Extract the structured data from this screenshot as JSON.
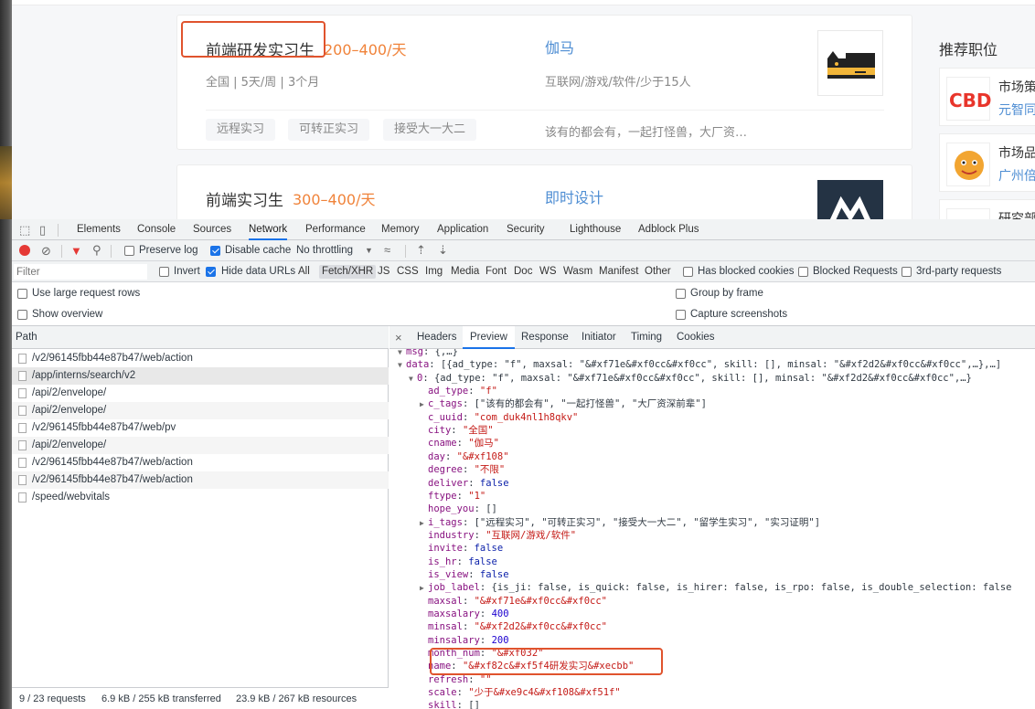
{
  "jobs": [
    {
      "title": "前端研发实习生",
      "salary": "200–400/天",
      "company": "伽马",
      "meta": "全国 | 5天/周 | 3个月",
      "company_meta": "互联网/游戏/软件/少于15人",
      "tags": [
        "远程实习",
        "可转正实习",
        "接受大一大二"
      ],
      "company_desc": "该有的都会有，一起打怪兽，大厂资…"
    },
    {
      "title": "前端实习生",
      "salary": "300–400/天",
      "company": "即时设计"
    }
  ],
  "sidebar": {
    "title": "推荐职位",
    "items": [
      {
        "name": "市场策",
        "company": "元智同",
        "logo": "CBD"
      },
      {
        "name": "市场品",
        "company": "广州倍"
      },
      {
        "name": "研究部"
      }
    ]
  },
  "devtools": {
    "tabs": [
      "Elements",
      "Console",
      "Sources",
      "Network",
      "Performance",
      "Memory",
      "Application",
      "Security",
      "Lighthouse",
      "Adblock Plus"
    ],
    "active_tab": "Network",
    "toolbar": {
      "preserve_log": "Preserve log",
      "disable_cache": "Disable cache",
      "throttling": "No throttling"
    },
    "filter": {
      "placeholder": "Filter",
      "invert": "Invert",
      "hide_data_urls": "Hide data URLs",
      "types": [
        "All",
        "Fetch/XHR",
        "JS",
        "CSS",
        "Img",
        "Media",
        "Font",
        "Doc",
        "WS",
        "Wasm",
        "Manifest",
        "Other"
      ],
      "active_type": "Fetch/XHR",
      "has_blocked_cookies": "Has blocked cookies",
      "blocked_requests": "Blocked Requests",
      "third_party": "3rd-party requests"
    },
    "options": {
      "large_rows": "Use large request rows",
      "overview": "Show overview",
      "group_by_frame": "Group by frame",
      "capture_screenshots": "Capture screenshots"
    },
    "requests": {
      "header": "Path",
      "rows": [
        "/v2/96145fbb44e87b47/web/action",
        "/app/interns/search/v2",
        "/api/2/envelope/",
        "/api/2/envelope/",
        "/v2/96145fbb44e87b47/web/pv",
        "/api/2/envelope/",
        "/v2/96145fbb44e87b47/web/action",
        "/v2/96145fbb44e87b47/web/action",
        "/speed/webvitals"
      ],
      "selected_index": 1
    },
    "status": {
      "requests": "9 / 23 requests",
      "transferred": "6.9 kB / 255 kB transferred",
      "resources": "23.9 kB / 267 kB resources"
    },
    "preview_tabs": [
      "Headers",
      "Preview",
      "Response",
      "Initiator",
      "Timing",
      "Cookies"
    ],
    "preview_active": "Preview",
    "json_lines": [
      {
        "indent": 1,
        "tri": "▼",
        "parts": [
          [
            "k",
            "msg"
          ],
          [
            "p",
            ": {,…}"
          ]
        ]
      },
      {
        "indent": 1,
        "tri": "▼",
        "parts": [
          [
            "k",
            "data"
          ],
          [
            "p",
            ": [{ad_type: \"f\", maxsal: \"&#xf71e&#xf0cc&#xf0cc\", skill: [], minsal: \"&#xf2d2&#xf0cc&#xf0cc\",…},…]"
          ]
        ]
      },
      {
        "indent": 2,
        "tri": "▼",
        "parts": [
          [
            "k",
            "0"
          ],
          [
            "p",
            ": {ad_type: \"f\", maxsal: \"&#xf71e&#xf0cc&#xf0cc\", skill: [], minsal: \"&#xf2d2&#xf0cc&#xf0cc\",…}"
          ]
        ]
      },
      {
        "indent": 3,
        "tri": "",
        "parts": [
          [
            "k",
            "ad_type"
          ],
          [
            "p",
            ": "
          ],
          [
            "s",
            "\"f\""
          ]
        ]
      },
      {
        "indent": 3,
        "tri": "▶",
        "parts": [
          [
            "k",
            "c_tags"
          ],
          [
            "p",
            ": [\"该有的都会有\", \"一起打怪兽\", \"大厂资深前辈\"]"
          ]
        ]
      },
      {
        "indent": 3,
        "tri": "",
        "parts": [
          [
            "k",
            "c_uuid"
          ],
          [
            "p",
            ": "
          ],
          [
            "s",
            "\"com_duk4nl1h8qkv\""
          ]
        ]
      },
      {
        "indent": 3,
        "tri": "",
        "parts": [
          [
            "k",
            "city"
          ],
          [
            "p",
            ": "
          ],
          [
            "s",
            "\"全国\""
          ]
        ]
      },
      {
        "indent": 3,
        "tri": "",
        "parts": [
          [
            "k",
            "cname"
          ],
          [
            "p",
            ": "
          ],
          [
            "s",
            "\"伽马\""
          ]
        ]
      },
      {
        "indent": 3,
        "tri": "",
        "parts": [
          [
            "k",
            "day"
          ],
          [
            "p",
            ": "
          ],
          [
            "s",
            "\"&#xf108\""
          ]
        ]
      },
      {
        "indent": 3,
        "tri": "",
        "parts": [
          [
            "k",
            "degree"
          ],
          [
            "p",
            ": "
          ],
          [
            "s",
            "\"不限\""
          ]
        ]
      },
      {
        "indent": 3,
        "tri": "",
        "parts": [
          [
            "k",
            "deliver"
          ],
          [
            "p",
            ": "
          ],
          [
            "b",
            "false"
          ]
        ]
      },
      {
        "indent": 3,
        "tri": "",
        "parts": [
          [
            "k",
            "ftype"
          ],
          [
            "p",
            ": "
          ],
          [
            "s",
            "\"1\""
          ]
        ]
      },
      {
        "indent": 3,
        "tri": "",
        "parts": [
          [
            "k",
            "hope_you"
          ],
          [
            "p",
            ": []"
          ]
        ]
      },
      {
        "indent": 3,
        "tri": "▶",
        "parts": [
          [
            "k",
            "i_tags"
          ],
          [
            "p",
            ": [\"远程实习\", \"可转正实习\", \"接受大一大二\", \"留学生实习\", \"实习证明\"]"
          ]
        ]
      },
      {
        "indent": 3,
        "tri": "",
        "parts": [
          [
            "k",
            "industry"
          ],
          [
            "p",
            ": "
          ],
          [
            "s",
            "\"互联网/游戏/软件\""
          ]
        ]
      },
      {
        "indent": 3,
        "tri": "",
        "parts": [
          [
            "k",
            "invite"
          ],
          [
            "p",
            ": "
          ],
          [
            "b",
            "false"
          ]
        ]
      },
      {
        "indent": 3,
        "tri": "",
        "parts": [
          [
            "k",
            "is_hr"
          ],
          [
            "p",
            ": "
          ],
          [
            "b",
            "false"
          ]
        ]
      },
      {
        "indent": 3,
        "tri": "",
        "parts": [
          [
            "k",
            "is_view"
          ],
          [
            "p",
            ": "
          ],
          [
            "b",
            "false"
          ]
        ]
      },
      {
        "indent": 3,
        "tri": "▶",
        "parts": [
          [
            "k",
            "job_label"
          ],
          [
            "p",
            ": {is_ji: false, is_quick: false, is_hirer: false, is_rpo: false, is_double_selection: false"
          ]
        ]
      },
      {
        "indent": 3,
        "tri": "",
        "parts": [
          [
            "k",
            "maxsal"
          ],
          [
            "p",
            ": "
          ],
          [
            "s",
            "\"&#xf71e&#xf0cc&#xf0cc\""
          ]
        ]
      },
      {
        "indent": 3,
        "tri": "",
        "parts": [
          [
            "k",
            "maxsalary"
          ],
          [
            "p",
            ": "
          ],
          [
            "n",
            "400"
          ]
        ]
      },
      {
        "indent": 3,
        "tri": "",
        "parts": [
          [
            "k",
            "minsal"
          ],
          [
            "p",
            ": "
          ],
          [
            "s",
            "\"&#xf2d2&#xf0cc&#xf0cc\""
          ]
        ]
      },
      {
        "indent": 3,
        "tri": "",
        "parts": [
          [
            "k",
            "minsalary"
          ],
          [
            "p",
            ": "
          ],
          [
            "n",
            "200"
          ]
        ]
      },
      {
        "indent": 3,
        "tri": "",
        "parts": [
          [
            "k",
            "month_num"
          ],
          [
            "p",
            ": "
          ],
          [
            "s",
            "\"&#xf032\""
          ]
        ]
      },
      {
        "indent": 3,
        "tri": "",
        "parts": [
          [
            "k",
            "name"
          ],
          [
            "p",
            ": "
          ],
          [
            "s",
            "\"&#xf82c&#xf5f4研发实习&#xecbb\""
          ]
        ]
      },
      {
        "indent": 3,
        "tri": "",
        "parts": [
          [
            "k",
            "refresh"
          ],
          [
            "p",
            ": "
          ],
          [
            "s",
            "\"\""
          ]
        ]
      },
      {
        "indent": 3,
        "tri": "",
        "parts": [
          [
            "k",
            "scale"
          ],
          [
            "p",
            ": "
          ],
          [
            "s",
            "\"少于&#xe9c4&#xf108&#xf51f\""
          ]
        ]
      },
      {
        "indent": 3,
        "tri": "",
        "parts": [
          [
            "k",
            "skill"
          ],
          [
            "p",
            ": []"
          ]
        ]
      }
    ]
  },
  "colors": {
    "accent": "#1a73e8",
    "salary": "#f0833a",
    "link": "#4f8ed3",
    "highlight": "#e0532d"
  }
}
